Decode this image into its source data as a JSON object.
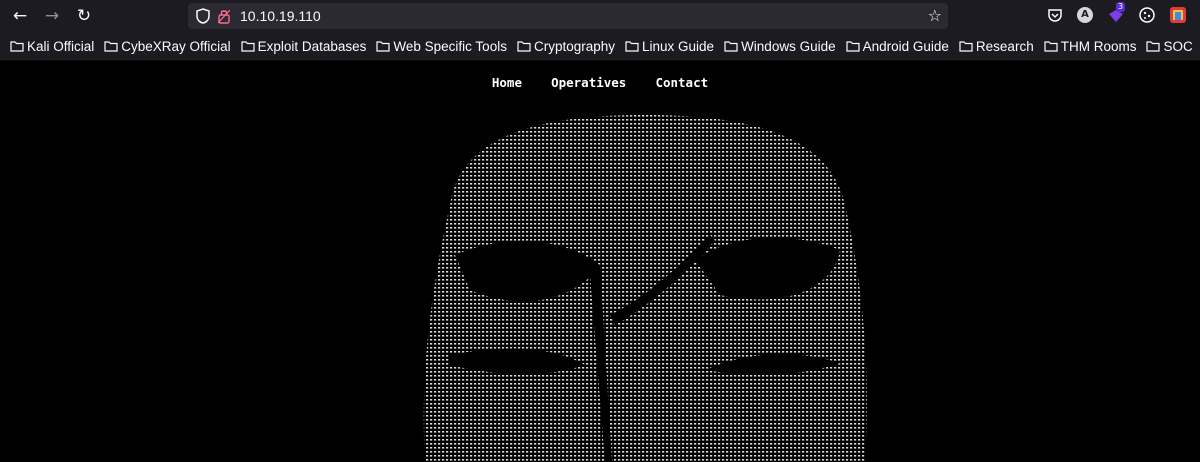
{
  "browser": {
    "url": "10.10.19.110",
    "badge_count": "3",
    "avatar_letter": "A"
  },
  "bookmarks": [
    "Kali Official",
    "CybeXRay Official",
    "Exploit Databases",
    "Web Specific Tools",
    "Cryptography",
    "Linux Guide",
    "Windows Guide",
    "Android Guide",
    "Research",
    "THM Rooms",
    "SOC"
  ],
  "site": {
    "nav": [
      "Home",
      "Operatives",
      "Contact"
    ]
  },
  "colors": {
    "toolbar_bg": "#1c1b22",
    "urlbar_bg": "#2b2a33",
    "page_bg": "#000000",
    "art_dots": "#d9d9d9"
  }
}
